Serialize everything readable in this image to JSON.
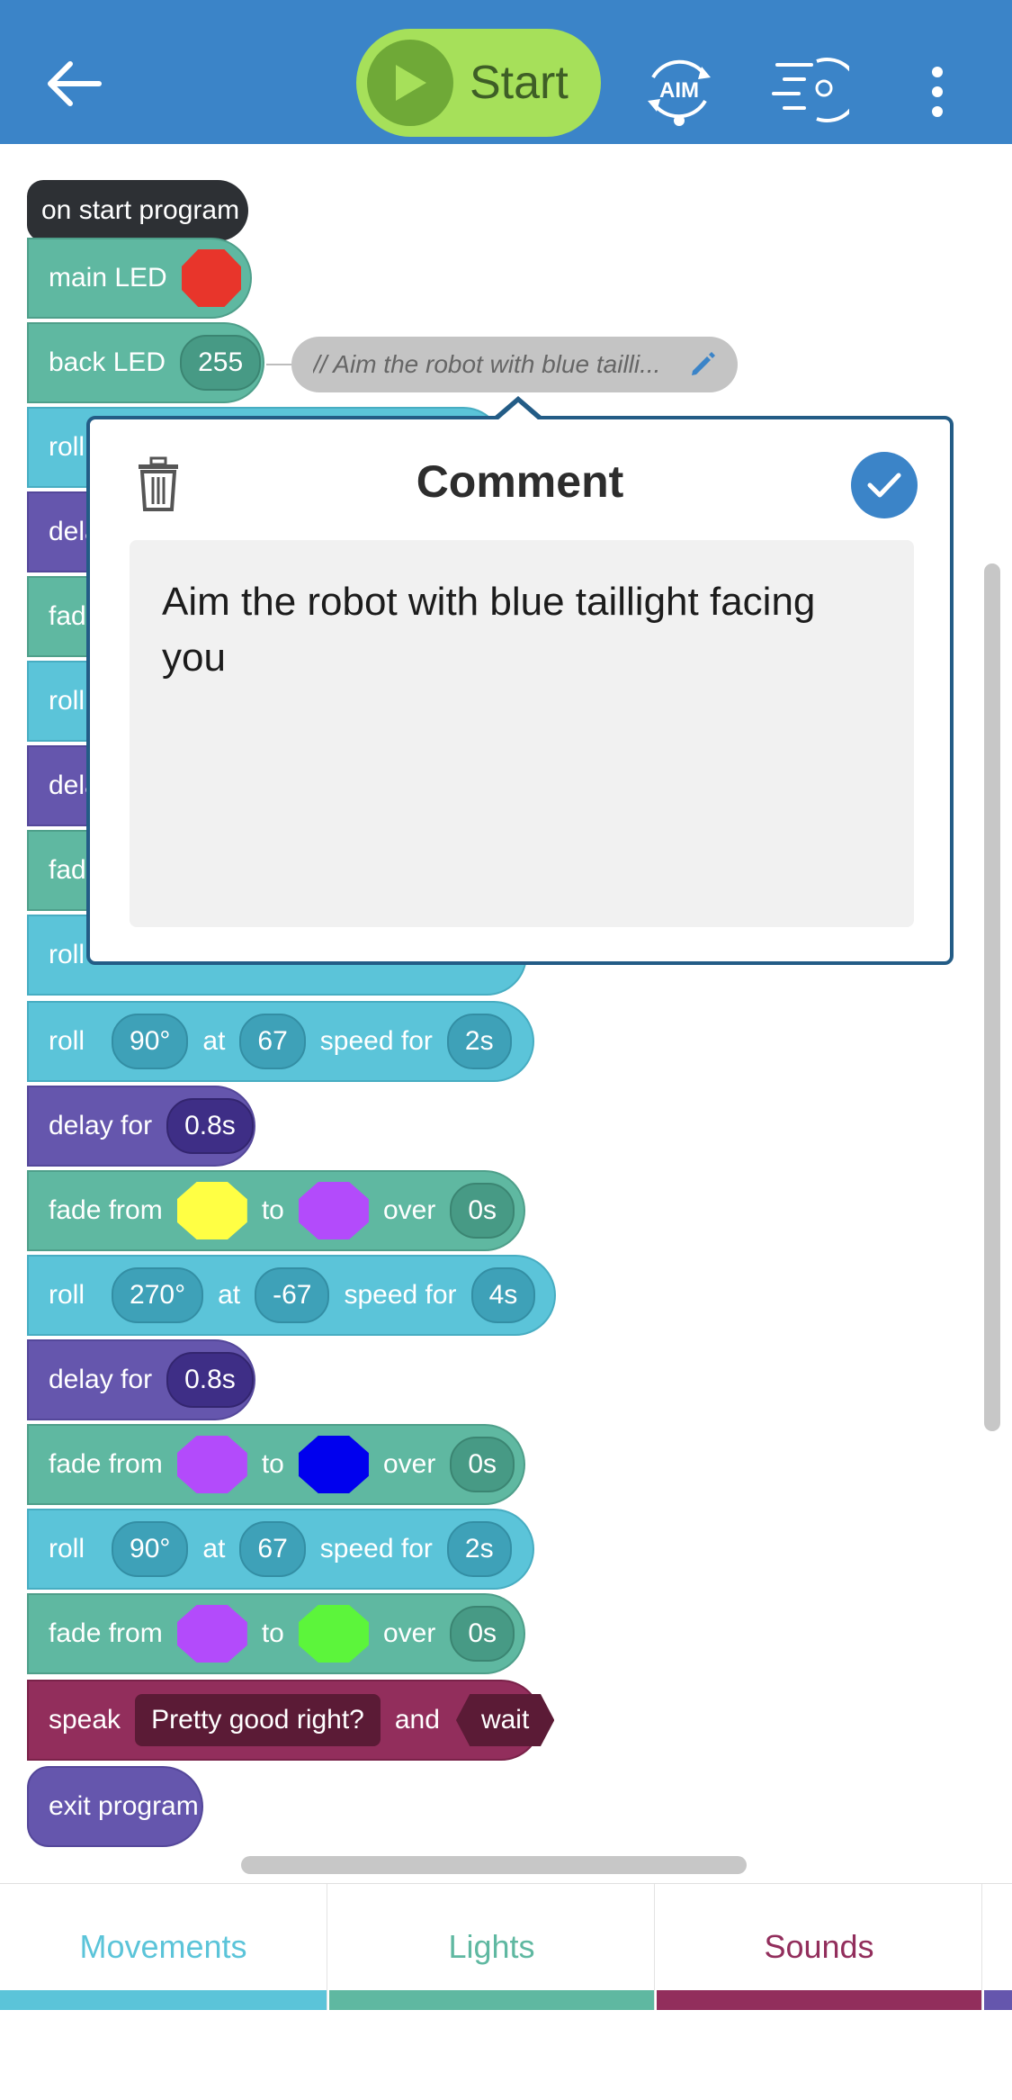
{
  "header": {
    "start_label": "Start",
    "aim_label": "AIM",
    "icons": [
      "back-arrow-icon",
      "play-icon",
      "aim-icon",
      "controller-icon",
      "more-vertical-icon"
    ],
    "accent": "#3b84c8",
    "start_color": "#a6e05a"
  },
  "program": {
    "start": "on start program",
    "blocks": [
      {
        "kind": "led",
        "label": "main LED",
        "color": "#e8352b"
      },
      {
        "kind": "back_led",
        "label": "back LED",
        "value": "255"
      },
      {
        "kind": "roll",
        "label": "roll"
      },
      {
        "kind": "delay",
        "label": "dela"
      },
      {
        "kind": "fade",
        "label": "fade"
      },
      {
        "kind": "roll",
        "label": "roll"
      },
      {
        "kind": "delay",
        "label": "dela"
      },
      {
        "kind": "fade",
        "label": "fade"
      },
      {
        "kind": "roll",
        "label": "roll"
      },
      {
        "kind": "roll",
        "label": "roll",
        "heading": "90°",
        "at": "at",
        "speed": "67",
        "speed_label": "speed for",
        "duration": "2s"
      },
      {
        "kind": "delay",
        "label": "delay for",
        "duration": "0.8s"
      },
      {
        "kind": "fade",
        "label": "fade from",
        "from": "#ffff44",
        "to_label": "to",
        "to": "#b34bfb",
        "over_label": "over",
        "duration": "0s"
      },
      {
        "kind": "roll",
        "label": "roll",
        "heading": "270°",
        "at": "at",
        "speed": "-67",
        "speed_label": "speed for",
        "duration": "4s"
      },
      {
        "kind": "delay",
        "label": "delay for",
        "duration": "0.8s"
      },
      {
        "kind": "fade",
        "label": "fade from",
        "from": "#b34bfb",
        "to_label": "to",
        "to": "#0000ee",
        "over_label": "over",
        "duration": "0s"
      },
      {
        "kind": "roll",
        "label": "roll",
        "heading": "90°",
        "at": "at",
        "speed": "67",
        "speed_label": "speed for",
        "duration": "2s"
      },
      {
        "kind": "fade",
        "label": "fade from",
        "from": "#b34bfb",
        "to_label": "to",
        "to": "#5cf53b",
        "over_label": "over",
        "duration": "0s"
      },
      {
        "kind": "speak",
        "label": "speak",
        "text": "Pretty good right?",
        "and_label": "and",
        "wait_label": "wait"
      },
      {
        "kind": "exit",
        "label": "exit program"
      }
    ]
  },
  "comment_chip": {
    "text": "// Aim the robot with blue tailli..."
  },
  "comment_dialog": {
    "title": "Comment",
    "text": "Aim the robot with blue taillight facing you"
  },
  "tabs": [
    {
      "label": "Movements",
      "color": "#5bc4d9"
    },
    {
      "label": "Lights",
      "color": "#5fb8a1"
    },
    {
      "label": "Sounds",
      "color": "#922e5c"
    }
  ]
}
